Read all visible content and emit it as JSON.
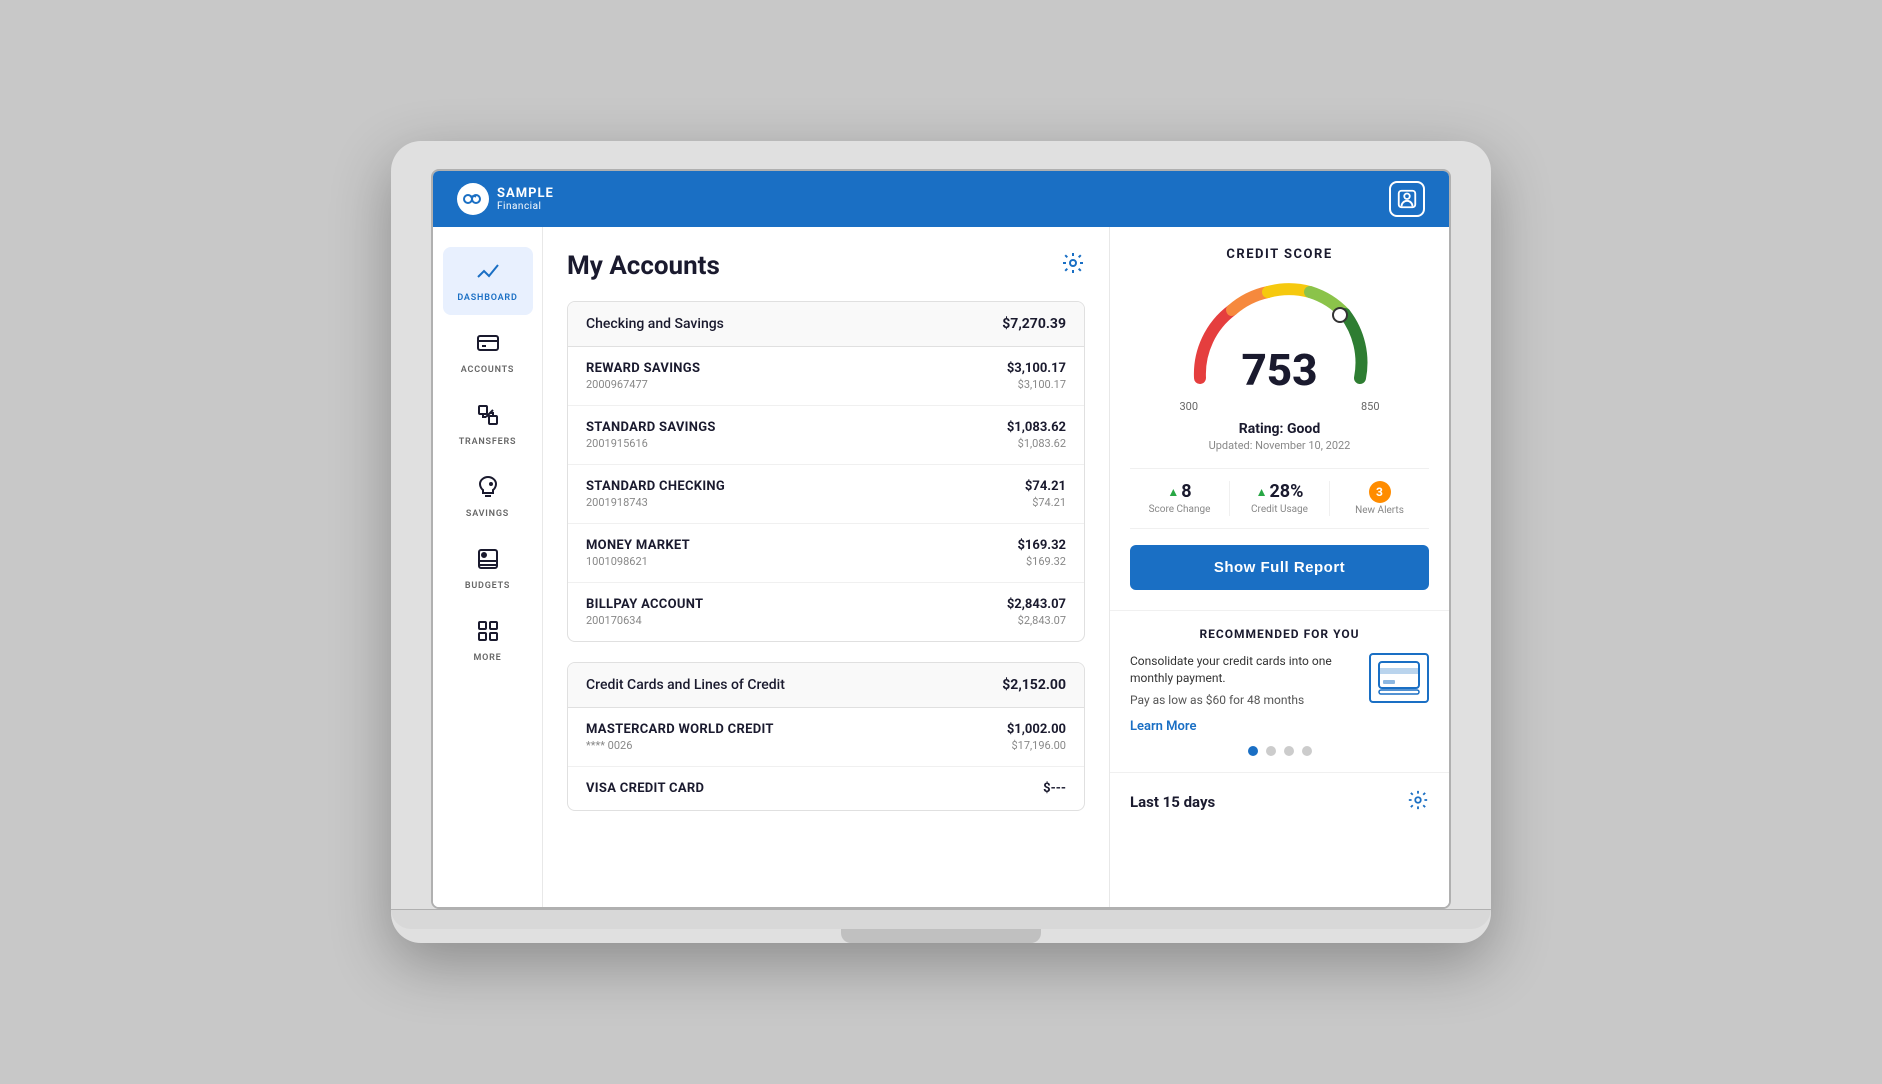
{
  "brand": {
    "sample_label": "SAMPLE",
    "financial_label": "Financial"
  },
  "top_nav": {
    "user_icon": "👤"
  },
  "sidebar": {
    "items": [
      {
        "id": "dashboard",
        "label": "DASHBOARD",
        "icon": "📊",
        "active": true
      },
      {
        "id": "accounts",
        "label": "ACCOUNTS",
        "icon": "💳",
        "active": false
      },
      {
        "id": "transfers",
        "label": "TRANSFERS",
        "icon": "🔄",
        "active": false
      },
      {
        "id": "savings",
        "label": "SAVINGS",
        "icon": "🐷",
        "active": false
      },
      {
        "id": "budgets",
        "label": "BUDGETS",
        "icon": "📋",
        "active": false
      },
      {
        "id": "more",
        "label": "MORE",
        "icon": "⊞",
        "active": false
      }
    ]
  },
  "accounts_panel": {
    "title": "My Accounts",
    "settings_icon": "⚙",
    "groups": [
      {
        "id": "checking-savings",
        "name": "Checking and Savings",
        "total": "$7,270.39",
        "accounts": [
          {
            "name": "REWARD SAVINGS",
            "number": "2000967477",
            "balance": "$3,100.17",
            "available": "$3,100.17"
          },
          {
            "name": "STANDARD SAVINGS",
            "number": "2001915616",
            "balance": "$1,083.62",
            "available": "$1,083.62"
          },
          {
            "name": "STANDARD CHECKING",
            "number": "2001918743",
            "balance": "$74.21",
            "available": "$74.21"
          },
          {
            "name": "MONEY MARKET",
            "number": "1001098621",
            "balance": "$169.32",
            "available": "$169.32"
          },
          {
            "name": "BILLPAY ACCOUNT",
            "number": "200170634",
            "balance": "$2,843.07",
            "available": "$2,843.07"
          }
        ]
      },
      {
        "id": "credit-cards",
        "name": "Credit Cards and Lines of Credit",
        "total": "$2,152.00",
        "accounts": [
          {
            "name": "MASTERCARD WORLD CREDIT",
            "number": "**** 0026",
            "balance": "$1,002.00",
            "available": "$17,196.00"
          },
          {
            "name": "VISA CREDIT CARD",
            "number": "",
            "balance": "$---",
            "available": ""
          }
        ]
      }
    ]
  },
  "credit_score": {
    "section_title": "CREDIT SCORE",
    "score": "753",
    "rating_label": "Rating: Good",
    "updated_label": "Updated: November 10, 2022",
    "min_label": "300",
    "max_label": "850",
    "stats": [
      {
        "value": "8",
        "arrow": "▲",
        "label": "Score Change",
        "color": "#28a745"
      },
      {
        "value": "28%",
        "arrow": "▲",
        "label": "Credit Usage",
        "color": "#28a745"
      },
      {
        "badge": "3",
        "label": "New Alerts"
      }
    ],
    "show_report_btn": "Show Full Report"
  },
  "recommended": {
    "title": "RECOMMENDED FOR YOU",
    "main_text": "Consolidate your credit cards into one monthly payment.",
    "sub_text": "Pay as low as $60 for 48 months",
    "learn_more_label": "Learn More",
    "dots": [
      true,
      false,
      false,
      false
    ]
  },
  "last_days": {
    "title": "Last 15 days"
  }
}
